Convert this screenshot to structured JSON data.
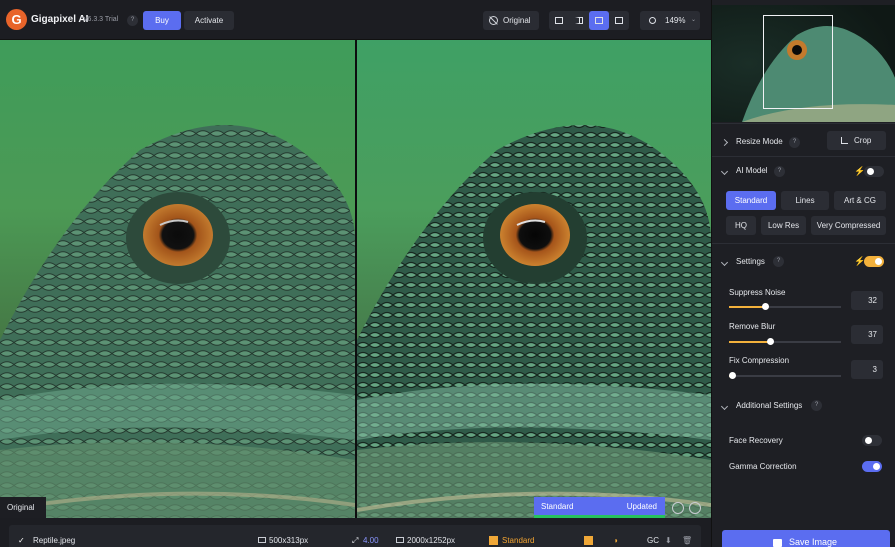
{
  "app": {
    "logo": "G",
    "title": "Gigapixel AI",
    "version": "v6.3.3 Trial",
    "help": "?",
    "buy_label": "Buy",
    "activate_label": "Activate"
  },
  "toolbar": {
    "original_label": "Original",
    "view_modes": [
      "single-view",
      "split-view",
      "side-by-side-view",
      "comparison-view"
    ],
    "active_view": "side-by-side-view",
    "zoom": "149%"
  },
  "canvas": {
    "left_badge": "Original",
    "status_left": "Standard",
    "status_right": "Updated",
    "progress": 1.0
  },
  "file": {
    "name": "Reptile.jpeg",
    "input_size": "500x313px",
    "scale": "4.00",
    "output_size": "2000x1252px",
    "model": "Standard",
    "gc": "GC"
  },
  "sidebar": {
    "resize_mode": {
      "label": "Resize Mode",
      "help": "?",
      "crop_label": "Crop"
    },
    "ai_model": {
      "label": "AI Model",
      "help": "?",
      "auto_on": false,
      "row1": [
        "Standard",
        "Lines",
        "Art & CG"
      ],
      "row2": [
        "HQ",
        "Low Res",
        "Very Compressed"
      ],
      "selected": "Standard"
    },
    "settings": {
      "label": "Settings",
      "help": "?",
      "auto_on": true,
      "suppress_noise": {
        "label": "Suppress Noise",
        "value": 32,
        "max": 100
      },
      "remove_blur": {
        "label": "Remove Blur",
        "value": 37,
        "max": 100
      },
      "fix_compression": {
        "label": "Fix Compression",
        "value": 3,
        "max": 100
      }
    },
    "additional": {
      "label": "Additional Settings",
      "help": "?",
      "face_recovery": {
        "label": "Face Recovery",
        "on": false
      },
      "gamma_correction": {
        "label": "Gamma Correction",
        "on": true
      }
    },
    "save_label": "Save Image"
  },
  "colors": {
    "accent": "#5b6df0",
    "warning": "#f3b13c",
    "brand_logo": "#e8642a",
    "progress": "#27c25e"
  }
}
